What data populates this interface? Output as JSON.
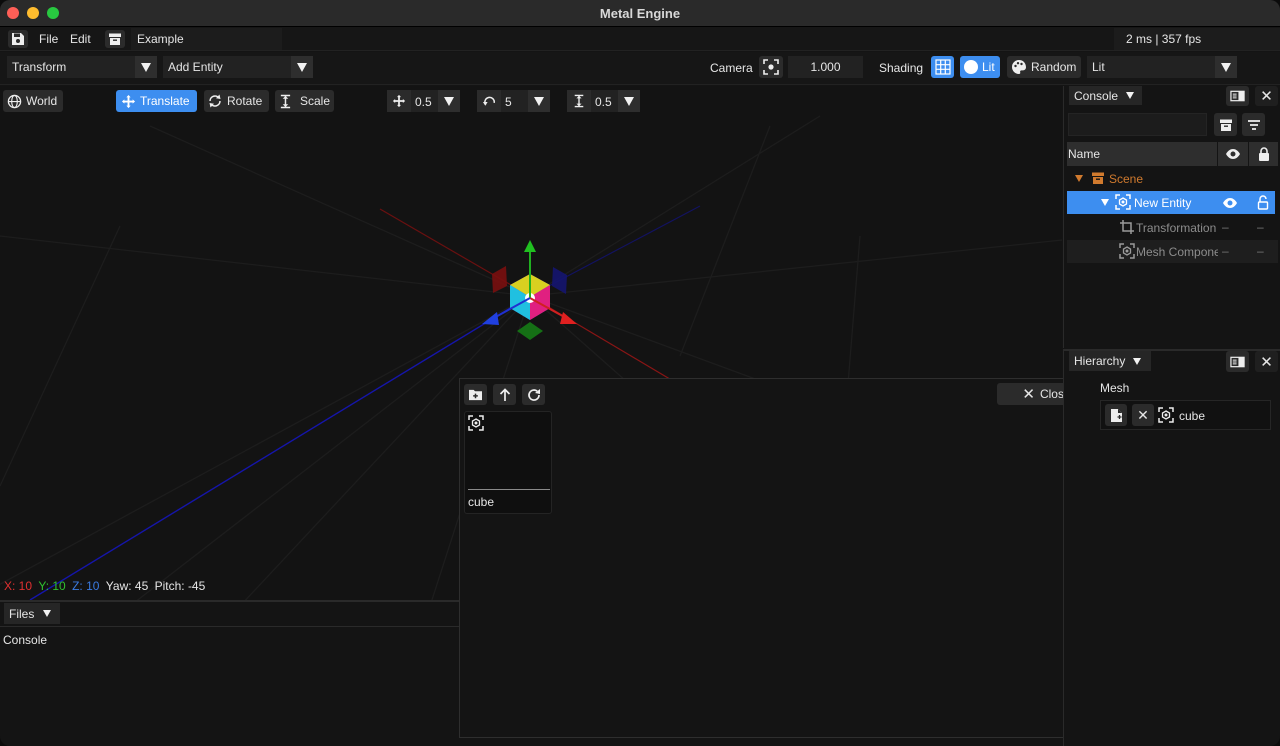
{
  "window": {
    "title": "Metal Engine"
  },
  "menu": {
    "file": "File",
    "edit": "Edit",
    "project_name": "Example",
    "perf": "2 ms | 357 fps"
  },
  "toolbar": {
    "transform_select": "Transform",
    "add_entity_select": "Add Entity",
    "camera_label": "Camera",
    "camera_value": "1.000",
    "shading_label": "Shading",
    "lit_toggle": "Lit",
    "random_button": "Random",
    "shading_select": "Lit"
  },
  "gizmo_bar": {
    "world": "World",
    "translate": "Translate",
    "rotate": "Rotate",
    "scale": "Scale",
    "translate_snap": "0.5",
    "rotate_snap": "5",
    "scale_snap": "0.5"
  },
  "viewport": {
    "status": {
      "x": "X: 10",
      "y": "Y: 10",
      "z": "Z: 10",
      "yaw": "Yaw: 45",
      "pitch": "Pitch: -45"
    }
  },
  "bottom_panel": {
    "tab": "Files",
    "content": "Console"
  },
  "file_browser": {
    "close": "Close",
    "items": [
      {
        "name": "cube",
        "icon": "mesh-icon"
      }
    ]
  },
  "hierarchy_panel": {
    "tab": "Console",
    "columns": {
      "name": "Name"
    },
    "tree": [
      {
        "label": "Scene",
        "icon": "archive-icon",
        "depth": 0
      },
      {
        "label": "New Entity",
        "icon": "mesh-icon",
        "depth": 1,
        "selected": true
      },
      {
        "label": "Transformation",
        "icon": "crop-icon",
        "depth": 2,
        "visibility": "–",
        "lock": "–"
      },
      {
        "label": "Mesh Component",
        "icon": "mesh-icon",
        "depth": 2,
        "visibility": "–",
        "lock": "–"
      }
    ]
  },
  "inspector_panel": {
    "tab": "Hierarchy",
    "section": "Mesh",
    "mesh_value": "cube"
  },
  "colors": {
    "accent": "#3d8ef0",
    "axis_x": "#e03030",
    "axis_y": "#30c030",
    "axis_z": "#3070e0",
    "scene_orange": "#d07a2e"
  }
}
